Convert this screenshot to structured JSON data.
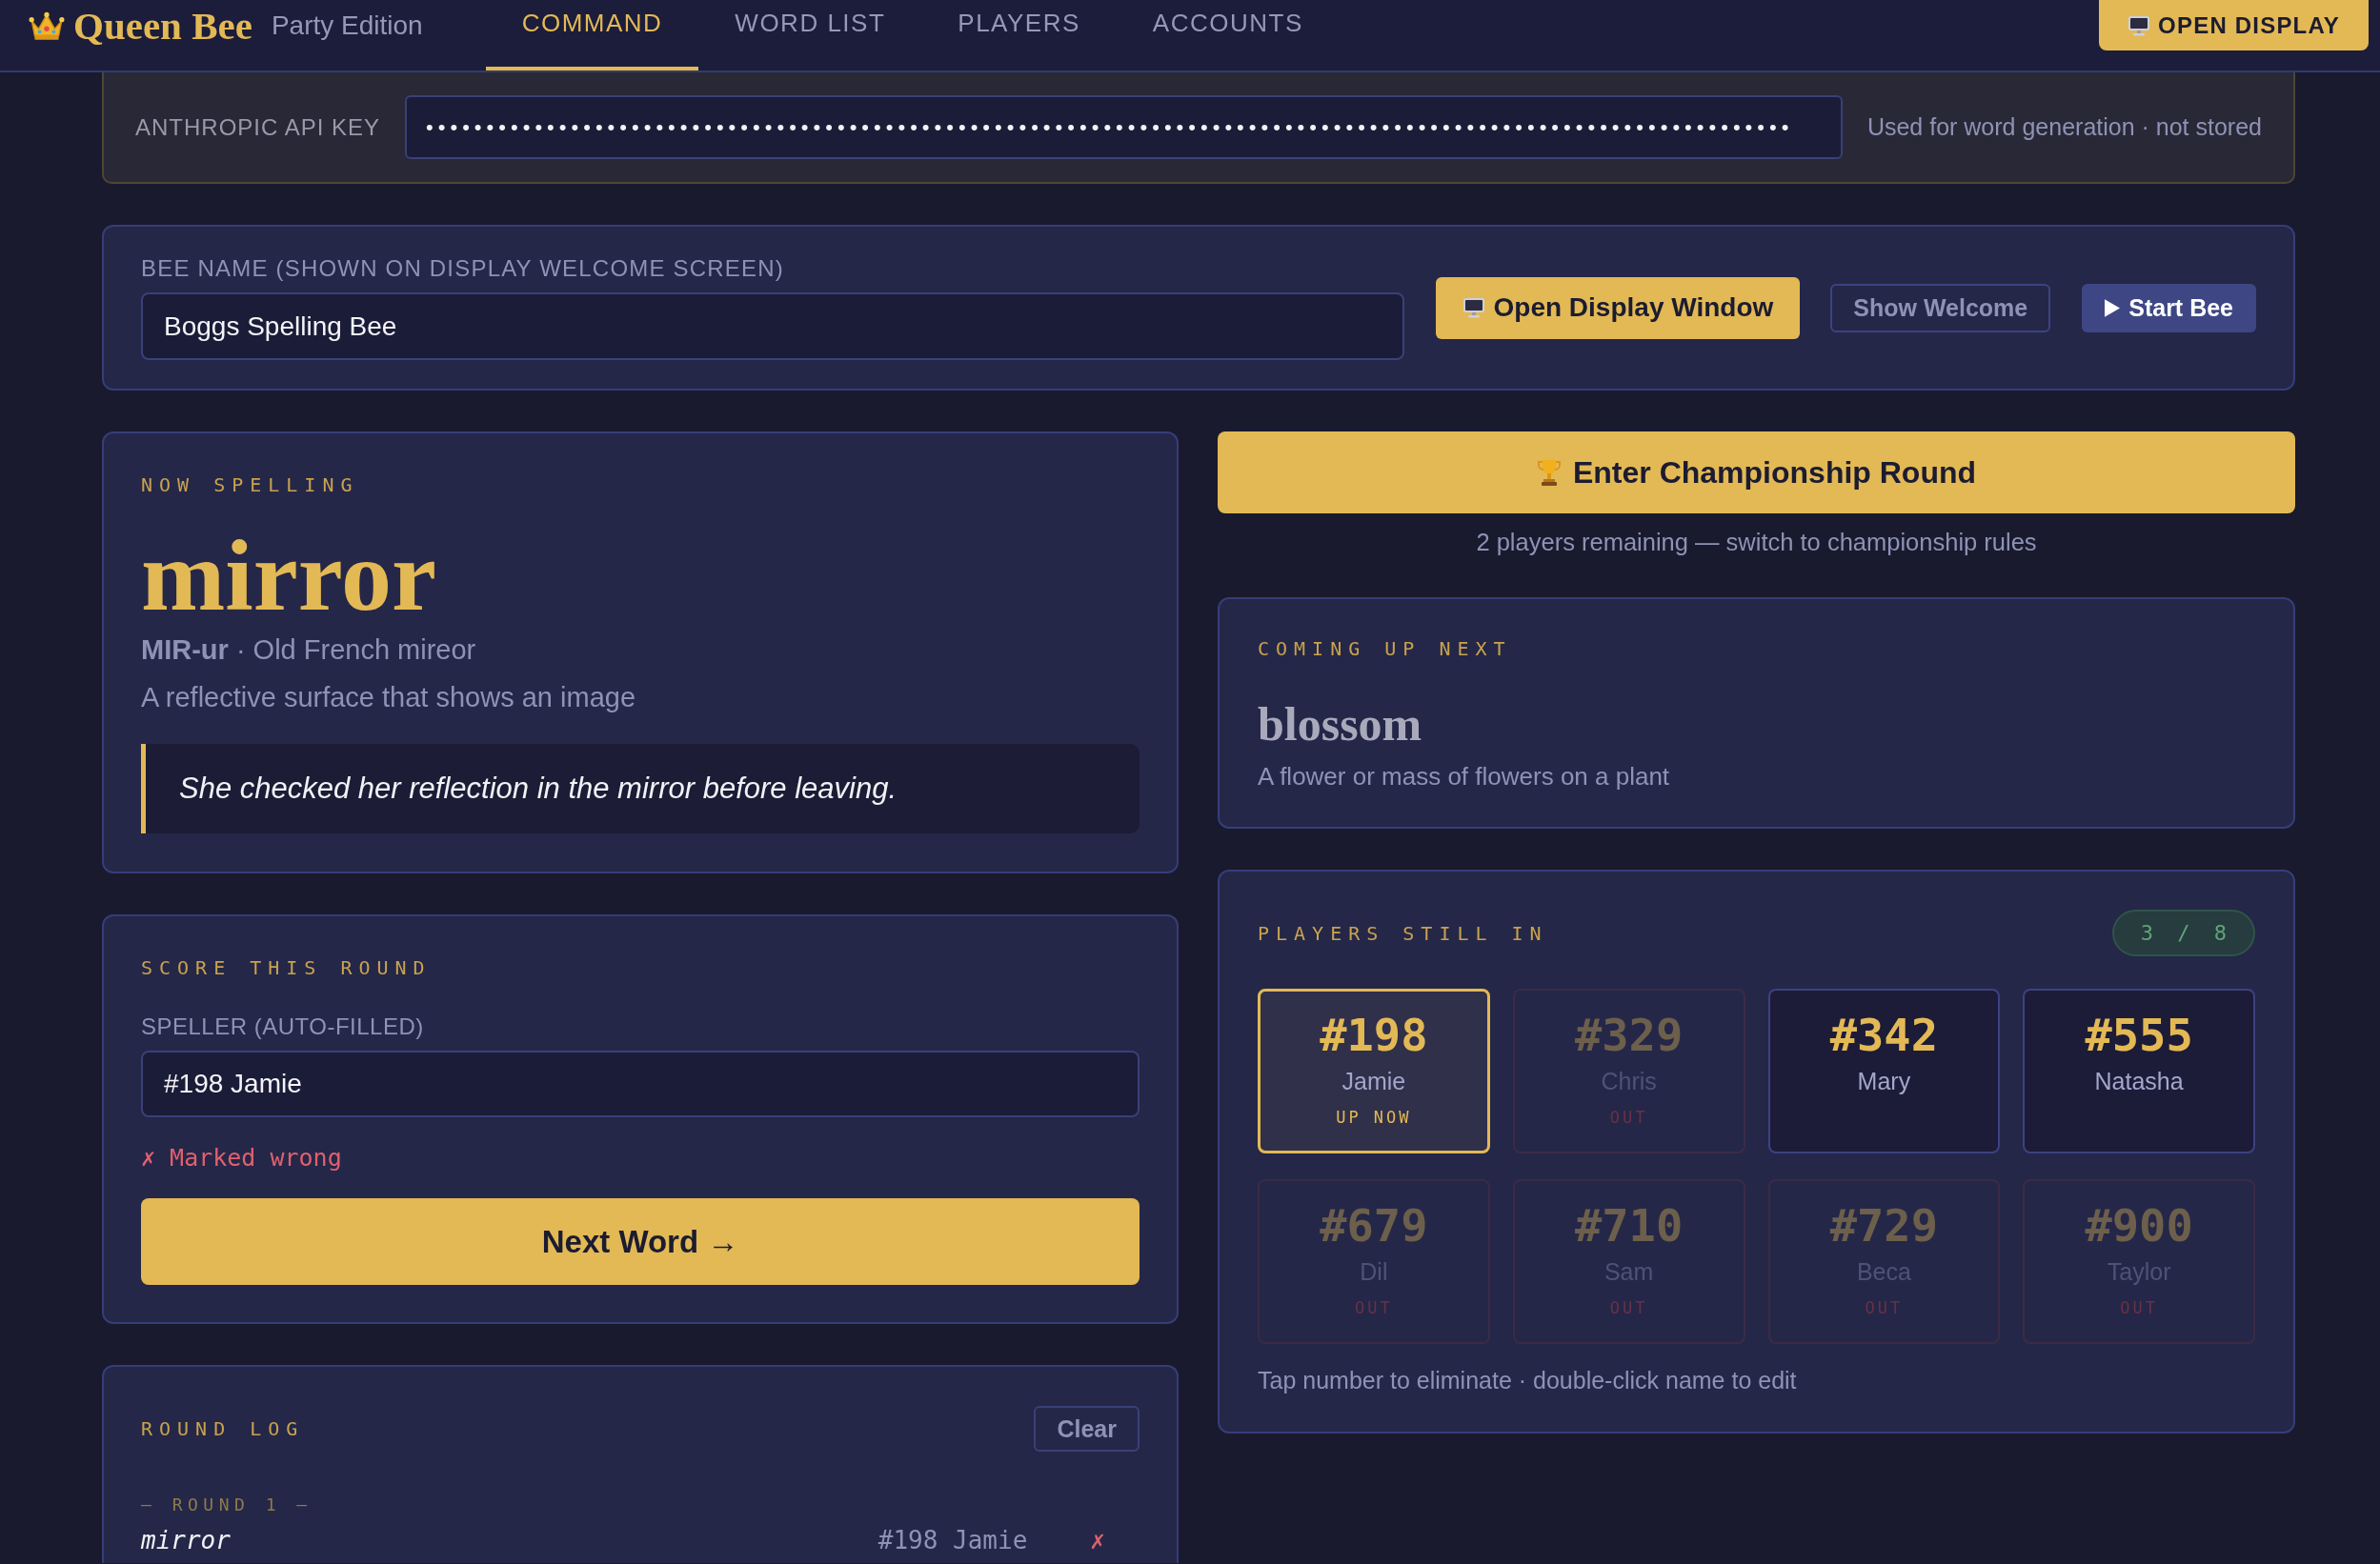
{
  "header": {
    "logo": "Queen Bee",
    "edition": "Party Edition",
    "tabs": [
      {
        "label": "COMMAND",
        "selected": true
      },
      {
        "label": "WORD LIST",
        "selected": false
      },
      {
        "label": "PLAYERS",
        "selected": false
      },
      {
        "label": "ACCOUNTS",
        "selected": false
      }
    ],
    "display_button": "OPEN DISPLAY"
  },
  "api_key": {
    "label": "ANTHROPIC API KEY",
    "value": "•••••••••••••••••••••••••••••••••••••••••••••••••••••••••••••••••••••••••••••••••••••••••••••••••••••••••••••••••",
    "hint": "Used for word generation · not stored"
  },
  "bee_name": {
    "label": "BEE NAME (SHOWN ON DISPLAY WELCOME SCREEN)",
    "value": "Boggs Spelling Bee",
    "buttons": [
      {
        "label": "Open Display Window",
        "kind": "primary"
      },
      {
        "label": "Show Welcome",
        "kind": "outline"
      },
      {
        "label": "Start Bee",
        "kind": "accent"
      }
    ]
  },
  "now_spelling": {
    "heading": "NOW SPELLING",
    "word": "mirror",
    "pronunciation": "**MIR-ur** · Old French mireor",
    "definition": "A reflective surface that shows an image",
    "example": "She checked her reflection in the mirror before leaving."
  },
  "score": {
    "heading": "SCORE THIS ROUND",
    "speller_label": "SPELLER (AUTO-FILLED)",
    "speller_value": "#198 Jamie",
    "result": "✗ Marked wrong",
    "next_button": "Next Word →"
  },
  "round_log": {
    "heading": "ROUND LOG",
    "clear_button": "Clear",
    "rounds": [
      {
        "title": "— ROUND 1 —",
        "entries": [
          {
            "word": "mirror",
            "speller": "#198 Jamie",
            "mark": "✗"
          }
        ]
      }
    ]
  },
  "championship": {
    "button": "Enter Championship Round",
    "note": "2 players remaining — switch to championship rules"
  },
  "coming_up": {
    "heading": "COMING UP NEXT",
    "word": "blossom",
    "definition": "A flower or mass of flowers on a plant"
  },
  "players": {
    "heading": "PLAYERS STILL IN",
    "count": "3 / 8",
    "items": [
      {
        "number": "#198",
        "name": "Jamie",
        "status": "UP NOW",
        "selected": true,
        "eliminated": false
      },
      {
        "number": "#329",
        "name": "Chris",
        "status": "OUT",
        "selected": false,
        "eliminated": true
      },
      {
        "number": "#342",
        "name": "Mary",
        "selected": false,
        "eliminated": false
      },
      {
        "number": "#555",
        "name": "Natasha",
        "selected": false,
        "eliminated": false
      },
      {
        "number": "#679",
        "name": "Dil",
        "status": "OUT",
        "selected": false,
        "eliminated": true
      },
      {
        "number": "#710",
        "name": "Sam",
        "status": "OUT",
        "selected": false,
        "eliminated": true
      },
      {
        "number": "#729",
        "name": "Beca",
        "status": "OUT",
        "selected": false,
        "eliminated": true
      },
      {
        "number": "#900",
        "name": "Taylor",
        "status": "OUT",
        "selected": false,
        "eliminated": true
      }
    ],
    "hint": "Tap number to eliminate · double-click name to edit"
  }
}
